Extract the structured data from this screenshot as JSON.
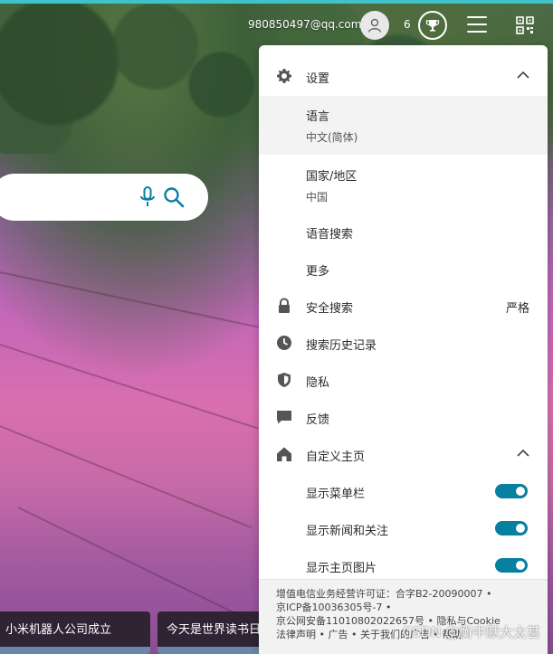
{
  "header": {
    "email": "980850497@qq.com",
    "points": "6",
    "avatar_icon": "user-icon",
    "rewards_icon": "trophy-icon",
    "menu_icon": "hamburger-menu-icon",
    "qr_icon": "qr-code-icon"
  },
  "search": {
    "mic_icon": "microphone-icon",
    "search_icon": "search-icon"
  },
  "news": [
    {
      "title": "小米机器人公司成立"
    },
    {
      "title": "今天是世界读书日"
    }
  ],
  "settings": {
    "title": "设置",
    "language_label": "语言",
    "language_value": "中文(简体)",
    "region_label": "国家/地区",
    "region_value": "中国",
    "voice_search": "语音搜索",
    "more": "更多",
    "safe_search": "安全搜索",
    "safe_search_value": "严格",
    "history": "搜索历史记录",
    "privacy": "隐私",
    "feedback": "反馈",
    "customize_home": "自定义主页",
    "show_menu_bar": "显示菜单栏",
    "show_news": "显示新闻和关注",
    "show_home_image": "显示主页图片",
    "toggles": {
      "menu_bar": true,
      "news": true,
      "home_image": true
    }
  },
  "footer": {
    "line1": "增值电信业务经营许可证：合字B2-20090007 •",
    "line2": "京ICP备10036305号-7 •",
    "line3": "京公网安备11010802022657号 • 隐私与Cookie",
    "line4": "法律声明 • 广告 • 关于我们的广告 • 帮助"
  },
  "watermark": "CSDN @衡中默大太甚",
  "colors": {
    "accent": "#067fa0",
    "top_accent": "#3fc3c9"
  }
}
